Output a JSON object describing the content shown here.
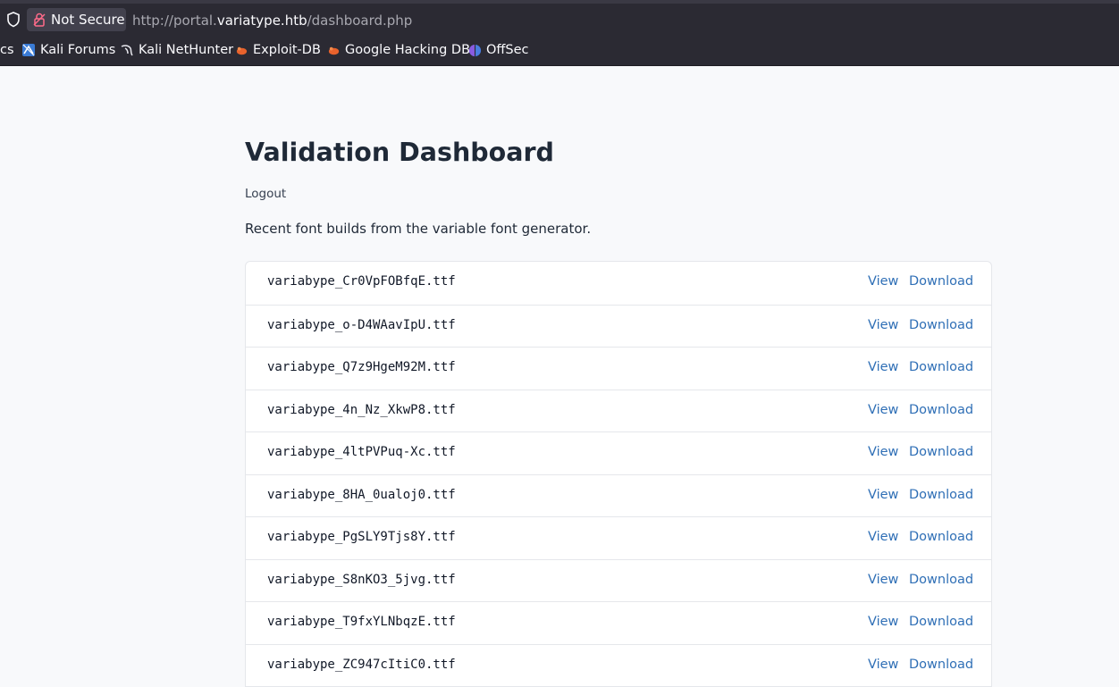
{
  "browser": {
    "security_label": "Not Secure",
    "url_prefix": "http://portal.",
    "url_host": "variatype.htb",
    "url_path": "/dashboard.php"
  },
  "bookmarks": [
    {
      "label": "cs",
      "icon": "none"
    },
    {
      "label": "Kali Forums",
      "icon": "kali-forums-icon"
    },
    {
      "label": "Kali NetHunter",
      "icon": "kali-dragon-icon"
    },
    {
      "label": "Exploit-DB",
      "icon": "exploit-db-icon"
    },
    {
      "label": "Google Hacking DB",
      "icon": "ghdb-icon"
    },
    {
      "label": "OffSec",
      "icon": "offsec-icon"
    }
  ],
  "page": {
    "title": "Validation Dashboard",
    "logout_label": "Logout",
    "intro": "Recent font builds from the variable font generator."
  },
  "actions": {
    "view_label": "View",
    "download_label": "Download"
  },
  "files": [
    "variabype_Cr0VpFOBfqE.ttf",
    "variabype_o-D4WAavIpU.ttf",
    "variabype_Q7z9HgeM92M.ttf",
    "variabype_4n_Nz_XkwP8.ttf",
    "variabype_4ltPVPuq-Xc.ttf",
    "variabype_8HA_0ualoj0.ttf",
    "variabype_PgSLY9Tjs8Y.ttf",
    "variabype_S8nKO3_5jvg.ttf",
    "variabype_T9fxYLNbqzE.ttf",
    "variabype_ZC947cItiC0.ttf"
  ],
  "colors": {
    "link": "#2f6fb6",
    "title": "#1f2937",
    "chrome": "#2b2a33"
  }
}
